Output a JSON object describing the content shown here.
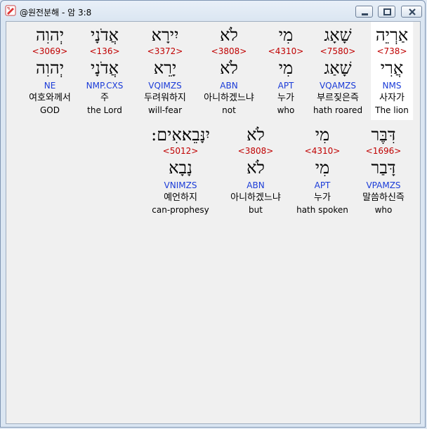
{
  "window": {
    "title": "@원전분해 - 암 3:8",
    "min_icon": "minimize-icon",
    "max_icon": "maximize-icon",
    "close_icon": "close-icon"
  },
  "rows": [
    {
      "words": [
        {
          "heb": "יְהוִה",
          "strong": "<3069>",
          "lemma": "יְהוִה",
          "code": "NE",
          "kor": "여호와께서",
          "eng": "GOD"
        },
        {
          "heb": "אֲדֹנָי",
          "strong": "<136>",
          "lemma": "אֲדֹנָי",
          "code": "NMP.CXS",
          "kor": "주",
          "eng": "the Lord"
        },
        {
          "heb": "יִירָא",
          "strong": "<3372>",
          "lemma": "יָרֵא",
          "code": "VQIMZS",
          "kor": "두려워하지",
          "eng": "will-fear"
        },
        {
          "heb": "לֹא",
          "strong": "<3808>",
          "lemma": "לֹא",
          "code": "ABN",
          "kor": "아니하겠느냐",
          "eng": "not"
        },
        {
          "heb": "מִי",
          "strong": "<4310>",
          "lemma": "מִי",
          "code": "APT",
          "kor": "누가",
          "eng": "who"
        },
        {
          "heb": "שָׁאָג",
          "strong": "<7580>",
          "lemma": "שָׁאַג",
          "code": "VQAMZS",
          "kor": "부르짖은즉",
          "eng": "hath roared"
        },
        {
          "heb": "אַרְיֵה",
          "strong": "<738>",
          "lemma": "אֲרִי",
          "code": "NMS",
          "kor": "사자가",
          "eng": "The lion",
          "highlight": true
        }
      ]
    },
    {
      "words": [
        {
          "heb": "יִנָּבֵא׃אִים:",
          "strong": "<5012>",
          "lemma": "נָבָא",
          "code": "VNIMZS",
          "kor": "예언하지",
          "eng": "can-prophesy"
        },
        {
          "heb": "לֹא",
          "strong": "<3808>",
          "lemma": "לֹא",
          "code": "ABN",
          "kor": "아니하겠느냐",
          "eng": "but"
        },
        {
          "heb": "מִי",
          "strong": "<4310>",
          "lemma": "מִי",
          "code": "APT",
          "kor": "누가",
          "eng": "hath spoken"
        },
        {
          "heb": "דִּבֶּר",
          "strong": "<1696>",
          "lemma": "דָּבַר",
          "code": "VPAMZS",
          "kor": "말씀하신즉",
          "eng": "who"
        }
      ]
    }
  ]
}
